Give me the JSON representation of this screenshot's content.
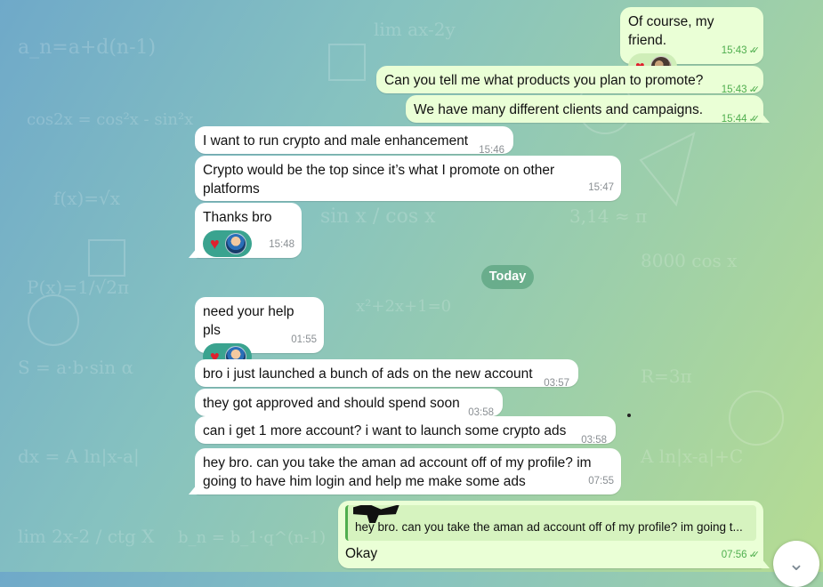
{
  "messages": [
    {
      "text": "Of course, my friend.",
      "time": "15:43"
    },
    {
      "text": "Can you tell me what products you plan to promote?",
      "time": "15:43"
    },
    {
      "text": "We have many different clients and campaigns.",
      "time": "15:44"
    },
    {
      "text": "I want to run crypto and male enhancement",
      "time": "15:46"
    },
    {
      "text": "Crypto would be the top since it’s what I promote on other platforms",
      "time": "15:47"
    },
    {
      "text": "Thanks bro",
      "time": "15:48"
    },
    {
      "text": "need your help pls",
      "time": "01:55"
    },
    {
      "text": "bro i just launched a bunch of ads on the new account",
      "time": "03:57"
    },
    {
      "text": "they got approved and should spend soon",
      "time": "03:58"
    },
    {
      "text": "can i get 1 more account? i want to launch some crypto ads",
      "time": "03:58"
    },
    {
      "text": "hey bro. can you take the aman ad account off of my profile? im going to have him login and help me make some ads",
      "time": "07:55"
    },
    {
      "text": "Okay",
      "time": "07:56",
      "reply_quote": "hey bro. can you take the aman ad account off of my profile? im going t..."
    }
  ],
  "date_separator": "Today",
  "ticks": "✓✓",
  "icons": {
    "reaction": "heart-icon",
    "scroll": "chevron-down-icon"
  },
  "colors": {
    "incoming_bubble": "#ffffff",
    "outgoing_bubble": "#eaffd6",
    "reaction_pill": "#3aa38f",
    "heart": "#e0202e"
  }
}
